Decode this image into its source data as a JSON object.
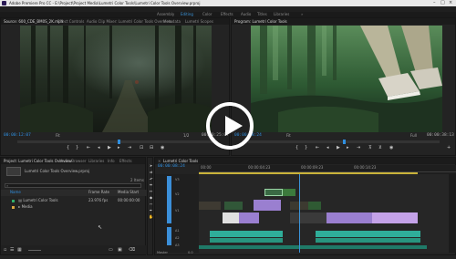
{
  "window": {
    "title": "Adobe Premiere Pro CC - E:\\Project\\Project Media\\Lumetri Color Tools\\Lumetri Color Tools Overview.prproj"
  },
  "menu": [
    "File",
    "Edit",
    "Clip",
    "Sequence",
    "Marker",
    "Title",
    "Window",
    "Help"
  ],
  "workspaces": [
    {
      "label": "Assembly",
      "active": false
    },
    {
      "label": "Editing",
      "active": true
    },
    {
      "label": "Color",
      "active": false
    },
    {
      "label": "Effects",
      "active": false
    },
    {
      "label": "Audio",
      "active": false
    },
    {
      "label": "Titles",
      "active": false
    },
    {
      "label": "Libraries",
      "active": false
    }
  ],
  "source_monitor": {
    "tabs": [
      "Source: 600_CDE_BM0S_2K.mp4",
      "Effect Controls",
      "Audio Clip Mixer: Lumetri Color Tools Overview",
      "Metadata",
      "Lumetri Scopes"
    ],
    "timecode_left": "00:00:12:07",
    "timecode_right": "00:00:25:07",
    "fit": "Fit",
    "res": "1/2"
  },
  "program_monitor": {
    "tabs": [
      "Program: Lumetri Color Tools"
    ],
    "timecode_left": "00:00:08:24",
    "timecode_right": "00:00:38:13",
    "fit": "Fit",
    "res": "Full"
  },
  "project": {
    "tabs": [
      "Project: Lumetri Color Tools Overview",
      "Media Browser",
      "Libraries",
      "Info",
      "Effects"
    ],
    "file": "Lumetri Color Tools Overview.prproj",
    "items_count": "2 Items",
    "col_name": "Name",
    "col_rate": "Frame Rate",
    "col_start": "Media Start",
    "items": [
      {
        "name": "Lumetri Color Tools",
        "rate": "23.976 fps",
        "start": "00:00:00:00",
        "color": "#2fae6c"
      },
      {
        "name": "Media",
        "rate": "",
        "start": "",
        "color": "#d9a640"
      }
    ]
  },
  "timeline": {
    "tab": "Lumetri Color Tools",
    "timecode": "00:00:08:24",
    "ruler": [
      "00:00",
      "00:00:04:23",
      "00:00:09:23",
      "00:00:14:23"
    ],
    "tracks": [
      "V3",
      "V2",
      "V1",
      "A1",
      "A2",
      "A3",
      "Master"
    ],
    "master_value": "0.0"
  },
  "colors": {
    "accent_blue": "#2f8fe0",
    "clip_video": "#9a7fd0",
    "clip_audio": "#2fae9a",
    "playhead": "#3b94d9"
  },
  "overlay": {
    "icon": "play-icon"
  }
}
